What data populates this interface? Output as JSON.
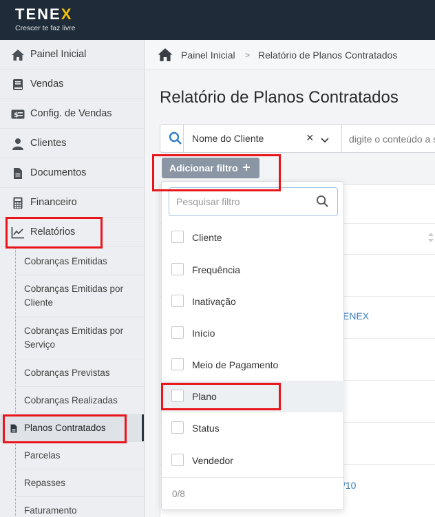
{
  "brand": {
    "name_part1": "TENE",
    "name_part2": "X",
    "tagline": "Crescer te faz livre",
    "accent": "#f2c200"
  },
  "sidebar": {
    "items": [
      {
        "label": "Painel Inicial",
        "icon": "home-icon"
      },
      {
        "label": "Vendas",
        "icon": "book-icon"
      },
      {
        "label": "Config. de Vendas",
        "icon": "money-icon"
      },
      {
        "label": "Clientes",
        "icon": "user-icon"
      },
      {
        "label": "Documentos",
        "icon": "document-icon"
      },
      {
        "label": "Financeiro",
        "icon": "calculator-icon"
      },
      {
        "label": "Relatórios",
        "icon": "chart-line-icon"
      }
    ],
    "sub_items": [
      {
        "label": "Cobranças Emitidas"
      },
      {
        "label": "Cobranças Emitidas por Cliente"
      },
      {
        "label": "Cobranças Emitidas por Serviço"
      },
      {
        "label": "Cobranças Previstas"
      },
      {
        "label": "Cobranças Realizadas"
      },
      {
        "label": "Planos Contratados"
      },
      {
        "label": "Parcelas"
      },
      {
        "label": "Repasses"
      },
      {
        "label": "Faturamento"
      }
    ]
  },
  "breadcrumb": {
    "home": "Painel Inicial",
    "separator": ">",
    "current": "Relatório de Planos Contratados"
  },
  "page": {
    "title": "Relatório de Planos Contratados"
  },
  "search": {
    "field_select": "Nome do Cliente",
    "clear_symbol": "×",
    "value_placeholder": "digite o conteúdo a ser pesquisado"
  },
  "filter": {
    "add_button": "Adicionar filtro",
    "search_placeholder": "Pesquisar filtro",
    "options": [
      "Cliente",
      "Frequência",
      "Inativação",
      "Início",
      "Meio de Pagamento",
      "Plano",
      "Status",
      "Vendedor"
    ],
    "selected_count": "0/8"
  },
  "table": {
    "visible_fragments": [
      "ENEX",
      "/10"
    ]
  },
  "highlight_color": "#e8151b"
}
